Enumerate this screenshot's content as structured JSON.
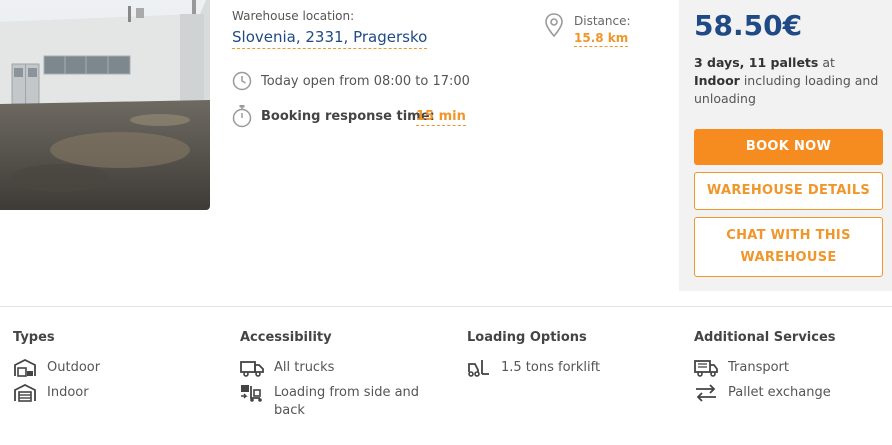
{
  "location": {
    "label": "Warehouse location:",
    "value": "Slovenia, 2331, Pragersko"
  },
  "distance": {
    "label": "Distance:",
    "value": "15.8 km"
  },
  "hours": {
    "text": "Today open from 08:00 to 17:00"
  },
  "response": {
    "label": "Booking response time:",
    "value": "15 min"
  },
  "pricing": {
    "price": "58.50€",
    "days": "3 days",
    "comma": ", ",
    "pallets": "11 pallets",
    "at": " at ",
    "type": "Indoor",
    "rest": "including loading and unloading"
  },
  "buttons": {
    "book": "BOOK NOW",
    "details": "WAREHOUSE DETAILS",
    "chat": "CHAT WITH THIS WAREHOUSE"
  },
  "features": {
    "types": {
      "title": "Types",
      "items": [
        "Outdoor",
        "Indoor"
      ]
    },
    "accessibility": {
      "title": "Accessibility",
      "items": [
        "All trucks",
        "Loading from side and back"
      ]
    },
    "loading": {
      "title": "Loading Options",
      "items": [
        "1.5 tons forklift"
      ]
    },
    "services": {
      "title": "Additional Services",
      "items": [
        "Transport",
        "Pallet exchange"
      ]
    }
  },
  "colors": {
    "brand": "#1f4a86",
    "accent": "#f68b1f",
    "panel": "#f2f2f2"
  }
}
